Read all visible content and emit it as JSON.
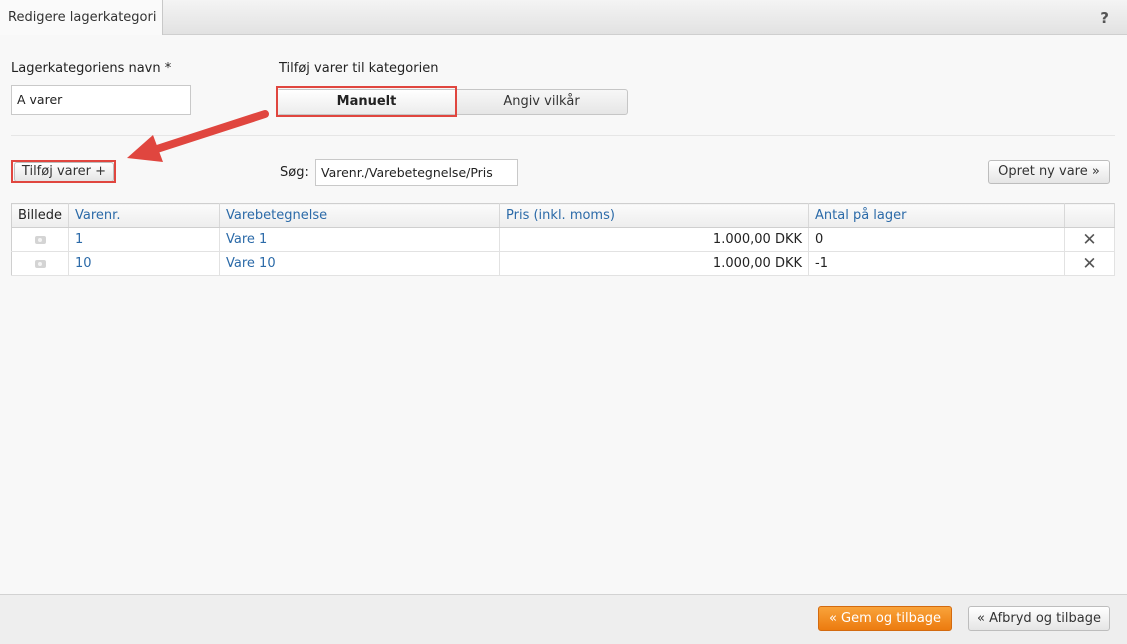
{
  "header": {
    "tab_title": "Redigere lagerkategori",
    "help_label": "?"
  },
  "form": {
    "name_label": "Lagerkategoriens navn *",
    "name_value": "A varer",
    "add_items_label": "Tilføj varer til kategorien",
    "mode_options": [
      "Manuelt",
      "Angiv vilkår"
    ],
    "selected_mode": "Manuelt"
  },
  "toolbar": {
    "add_items_button": "Tilføj varer +",
    "search_label": "Søg:",
    "search_value": "Varenr./Varebetegnelse/Pris",
    "create_new_button": "Opret ny vare »"
  },
  "table": {
    "columns": [
      "Billede",
      "Varenr.",
      "Varebetegnelse",
      "Pris (inkl. moms)",
      "Antal på lager"
    ],
    "rows": [
      {
        "image_icon": "camera-icon",
        "item_no": "1",
        "description": "Vare 1",
        "price": "1.000,00 DKK",
        "stock": "0"
      },
      {
        "image_icon": "camera-icon",
        "item_no": "10",
        "description": "Vare 10",
        "price": "1.000,00 DKK",
        "stock": "-1"
      }
    ],
    "delete_icon": "close-icon"
  },
  "footer": {
    "save_button": "« Gem og tilbage",
    "cancel_button": "« Afbryd og tilbage"
  },
  "colors": {
    "highlight": "#e0463f",
    "link": "#2b6aa8",
    "primary": "#ec7b0f"
  }
}
